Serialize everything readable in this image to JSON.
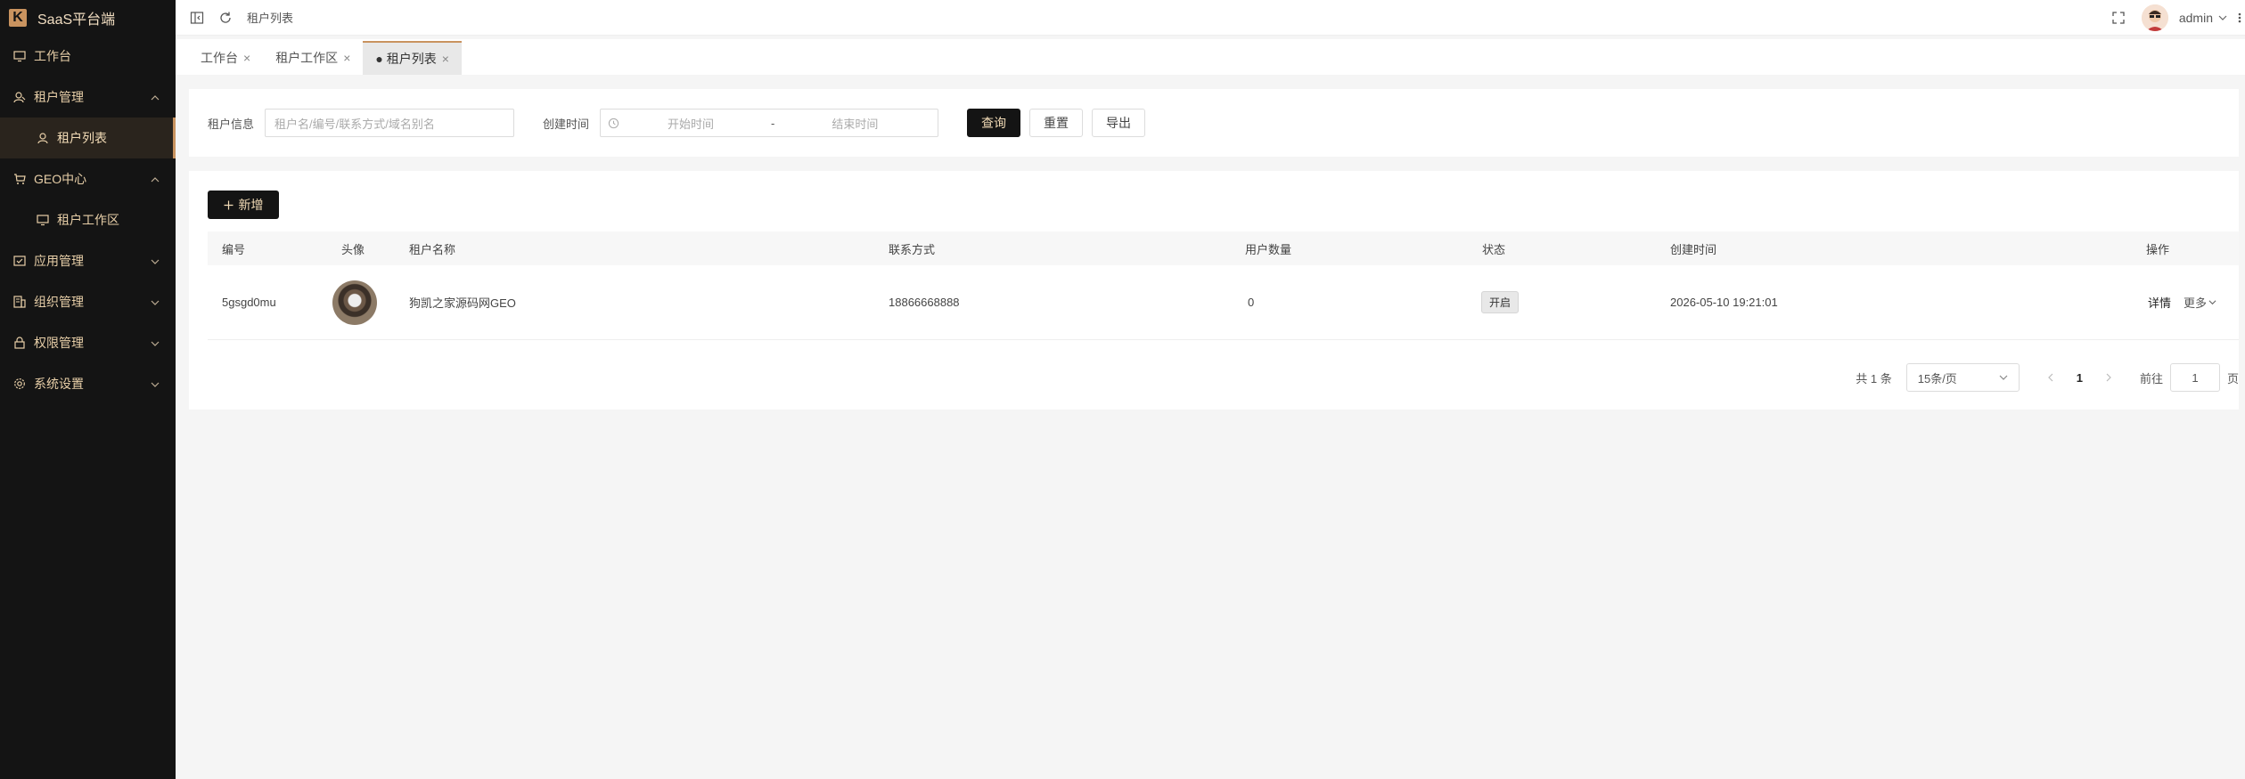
{
  "app": {
    "title": "SaaS平台端",
    "logo_letter": "K",
    "accent_color": "#c9935f"
  },
  "sidebar": {
    "items": [
      {
        "label": "工作台",
        "icon": "monitor-icon"
      },
      {
        "label": "租户管理",
        "icon": "user-manage-icon",
        "expanded": true
      },
      {
        "label": "租户列表",
        "icon": "user-icon",
        "active": true,
        "sub": true
      },
      {
        "label": "GEO中心",
        "icon": "cart-icon",
        "expanded": true
      },
      {
        "label": "租户工作区",
        "icon": "monitor-icon",
        "sub": true
      },
      {
        "label": "应用管理",
        "icon": "app-icon"
      },
      {
        "label": "组织管理",
        "icon": "org-icon"
      },
      {
        "label": "权限管理",
        "icon": "lock-icon"
      },
      {
        "label": "系统设置",
        "icon": "gear-icon"
      }
    ]
  },
  "header": {
    "breadcrumb": "租户列表",
    "user": "admin"
  },
  "tabs": [
    {
      "label": "工作台",
      "close": "×"
    },
    {
      "label": "租户工作区",
      "close": "×"
    },
    {
      "label": "● 租户列表",
      "close": "×",
      "active": true
    }
  ],
  "search": {
    "tenant_label": "租户信息",
    "tenant_placeholder": "租户名/编号/联系方式/域名别名",
    "created_label": "创建时间",
    "start_placeholder": "开始时间",
    "range_sep": "-",
    "end_placeholder": "结束时间",
    "query_btn": "查询",
    "reset_btn": "重置",
    "export_btn": "导出"
  },
  "table": {
    "add_btn": "新增",
    "columns": [
      "编号",
      "头像",
      "租户名称",
      "联系方式",
      "用户数量",
      "状态",
      "创建时间",
      "操作"
    ],
    "rows": [
      {
        "id": "5gsgd0mu",
        "name": "狗凯之家源码网GEO",
        "contact": "18866668888",
        "users": "0",
        "status": "开启",
        "created": "2026-05-10 19:21:01",
        "detail": "详情",
        "more": "更多"
      }
    ]
  },
  "pagination": {
    "total": "共 1 条",
    "page_size": "15条/页",
    "current": "1",
    "goto": "前往",
    "goto_value": "1",
    "page_unit": "页"
  }
}
